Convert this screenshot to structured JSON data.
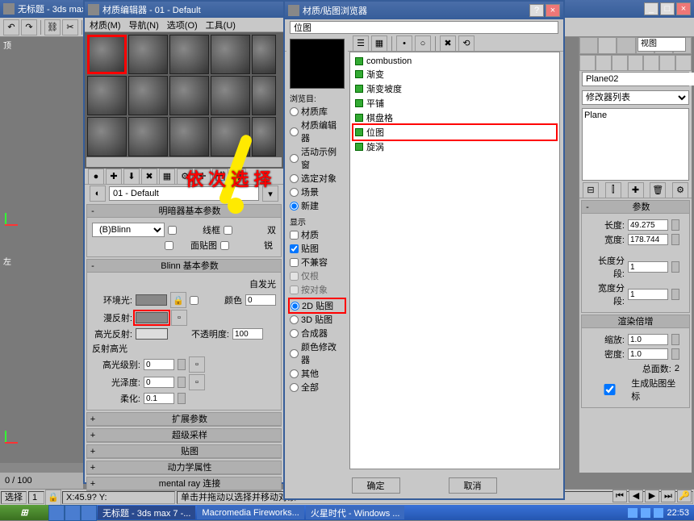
{
  "app": {
    "title": "无标题 - 3ds max"
  },
  "mat_editor": {
    "title": "材质编辑器 - 01 - Default",
    "menus": [
      "材质(M)",
      "导航(N)",
      "选项(O)",
      "工具(U)"
    ],
    "name_label": "01 - Default",
    "annotation": "依  次  选  择"
  },
  "rollouts": {
    "shader": {
      "title": "明暗器基本参数",
      "shader": "(B)Blinn",
      "wire": "线框",
      "two": "双",
      "facemap": "面贴图",
      "faceted": "锐"
    },
    "blinn": {
      "title": "Blinn 基本参数",
      "selfillum": "自发光",
      "color_cb": "颜色",
      "color_val": "0",
      "ambient": "环境光:",
      "diffuse": "漫反射:",
      "specular": "高光反射:",
      "opacity": "不透明度:",
      "opacity_val": "100",
      "spec_hl": "反射高光",
      "spec_level": "高光级别:",
      "spec_level_val": "0",
      "gloss": "光泽度:",
      "gloss_val": "0",
      "soften": "柔化:",
      "soften_val": "0.1"
    },
    "extra": [
      "扩展参数",
      "超级采样",
      "贴图",
      "动力学属性",
      "mental ray 连接"
    ]
  },
  "browse_side": {
    "label1": "浏览目:",
    "opts1": [
      "材质库",
      "材质编辑器",
      "活动示例窗",
      "选定对象",
      "场景",
      "新建"
    ],
    "sel1": "新建",
    "label2": "显示",
    "cb1": "材质",
    "cb2": "贴图",
    "cb3": "不兼容",
    "cb4": "仅根",
    "cb5": "按对象",
    "opts2": [
      "2D 贴图",
      "3D 贴图",
      "合成器",
      "颜色修改器",
      "其他",
      "全部"
    ],
    "sel2": "2D 贴图"
  },
  "mat_browser": {
    "title": "材质/贴图浏览器",
    "field": "位图",
    "items": [
      "combustion",
      "渐变",
      "渐变坡度",
      "平铺",
      "棋盘格",
      "位图",
      "旋涡"
    ],
    "highlighted": "位图",
    "ok": "确定",
    "cancel": "取消"
  },
  "cmd_panel": {
    "obj_name": "Plane02",
    "mod_dropdown": "修改器列表",
    "stack_item": "Plane",
    "params": {
      "title": "参数",
      "length": "长度:",
      "length_v": "49.275",
      "width": "宽度:",
      "width_v": "178.744",
      "lseg": "长度分段:",
      "lseg_v": "1",
      "wseg": "宽度分段:",
      "wseg_v": "1"
    },
    "render": {
      "title": "渲染倍增",
      "scale": "缩放:",
      "scale_v": "1.0",
      "density": "密度:",
      "density_v": "1.0",
      "total": "总面数:",
      "total_v": "2",
      "gen": "生成贴图坐标"
    }
  },
  "right_dropdown": "视图",
  "viewport": {
    "top": "顶",
    "left": "左"
  },
  "timeline": {
    "range": "0 / 100",
    "cur": "0"
  },
  "status": {
    "sel": "选择",
    "sel_count": "1",
    "coords": "X:45.9?  Y:",
    "grid": "",
    "prompt": "单击并拖动以选择并移动对象"
  },
  "playback": {
    "icons": [
      "⏮",
      "◀",
      "▶",
      "⏭",
      "🔑"
    ]
  },
  "taskbar": {
    "items": [
      {
        "label": "无标题 - 3ds max 7 -...",
        "active": true
      },
      {
        "label": "Macromedia Fireworks..."
      },
      {
        "label": "火星时代 - Windows ..."
      }
    ],
    "time": "22:53"
  }
}
